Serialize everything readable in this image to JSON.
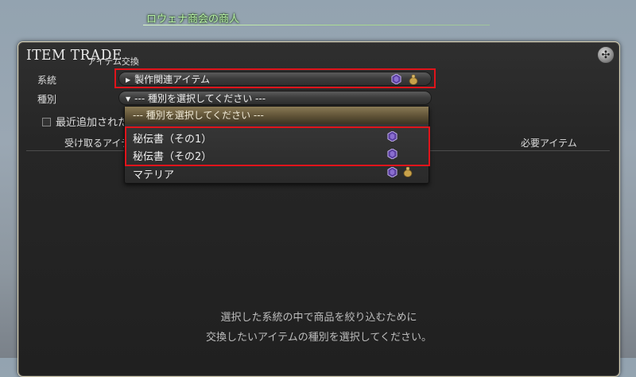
{
  "npc_name": "ロウェナ商会の商人",
  "window": {
    "title": "ITEM TRADE",
    "subtitle": "アイテム交換",
    "close_icon": "close-icon"
  },
  "filters": {
    "category_label": "系統",
    "category_value": "製作関連アイテム",
    "type_label": "種別",
    "type_value": "--- 種別を選択してください ---"
  },
  "recent_checkbox_label": "最近追加されたアイテム",
  "columns": {
    "receive": "受け取るアイテム",
    "required": "必要アイテム"
  },
  "dropdown": {
    "header": "--- 種別を選択してください ---",
    "items": [
      {
        "label": "秘伝書（その1）",
        "icons": [
          "gem-icon"
        ]
      },
      {
        "label": "秘伝書（その2）",
        "icons": [
          "gem-icon"
        ]
      },
      {
        "label": "マテリア",
        "icons": [
          "gem-icon",
          "bag-icon"
        ]
      }
    ]
  },
  "hint": {
    "line1": "選択した系統の中で商品を絞り込むために",
    "line2": "交換したいアイテムの種別を選択してください。"
  },
  "colors": {
    "highlight": "#e0141b",
    "npc_name": "#b8f1a6",
    "gem": "#5a3fa0",
    "bag": "#c8a24a"
  }
}
